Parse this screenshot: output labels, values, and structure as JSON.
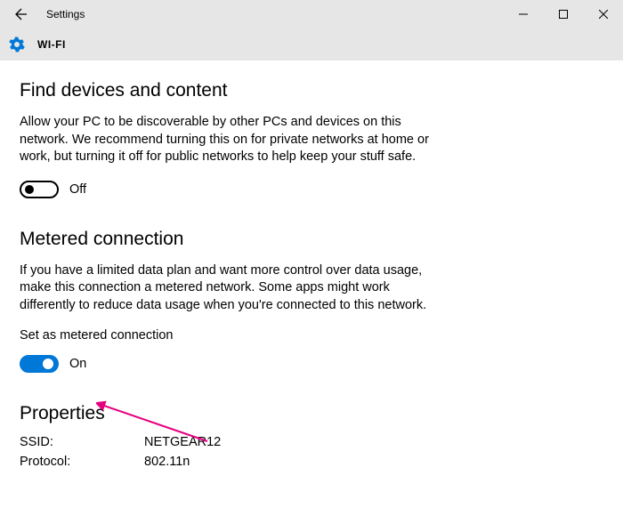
{
  "titlebar": {
    "title": "Settings"
  },
  "subheader": {
    "title": "WI-FI"
  },
  "sections": {
    "find": {
      "title": "Find devices and content",
      "desc": "Allow your PC to be discoverable by other PCs and devices on this network. We recommend turning this on for private networks at home or work, but turning it off for public networks to help keep your stuff safe.",
      "toggle_label": "Off"
    },
    "metered": {
      "title": "Metered connection",
      "desc": "If you have a limited data plan and want more control over data usage, make this connection a metered network. Some apps might work differently to reduce data usage when you're connected to this network.",
      "setting_label": "Set as metered connection",
      "toggle_label": "On"
    },
    "properties": {
      "title": "Properties",
      "rows": [
        {
          "key": "SSID:",
          "value": "NETGEAR12"
        },
        {
          "key": "Protocol:",
          "value": "802.11n"
        }
      ]
    }
  }
}
